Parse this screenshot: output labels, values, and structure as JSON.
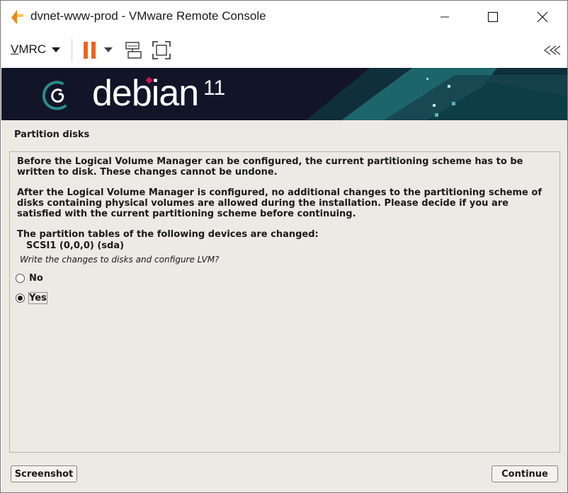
{
  "window": {
    "title": "dvnet-www-prod - VMware Remote Console",
    "controls": [
      "minimize-icon",
      "maximize-icon",
      "close-icon"
    ]
  },
  "toolbar": {
    "vmrc_menu_accel": "V",
    "vmrc_menu_rest": "MRC",
    "buttons": [
      "pause-icon",
      "dropdown-arrow-icon",
      "send-ctrl-alt-del-icon",
      "fullscreen-icon",
      "collapse-icon"
    ],
    "colors": {
      "pause": "#e8671d"
    }
  },
  "banner": {
    "logo": "debian",
    "version": "11",
    "colors": {
      "background": "#111527",
      "accent": "#d70a53",
      "teal": "#1f6b71"
    }
  },
  "installer": {
    "heading": "Partition disks",
    "paragraph1": "Before the Logical Volume Manager can be configured, the current partitioning scheme has to be written to disk. These changes cannot be undone.",
    "paragraph2": "After the Logical Volume Manager is configured, no additional changes to the partitioning scheme of disks containing physical volumes are allowed during the installation. Please decide if you are satisfied with the current partitioning scheme before continuing.",
    "paragraph3": "The partition tables of the following devices are changed:",
    "device": "SCSI1 (0,0,0) (sda)",
    "question": "Write the changes to disks and configure LVM?",
    "options": [
      {
        "label": "No",
        "selected": false
      },
      {
        "label": "Yes",
        "selected": true
      }
    ],
    "screenshot_button": "Screenshot",
    "continue_button": "Continue"
  }
}
